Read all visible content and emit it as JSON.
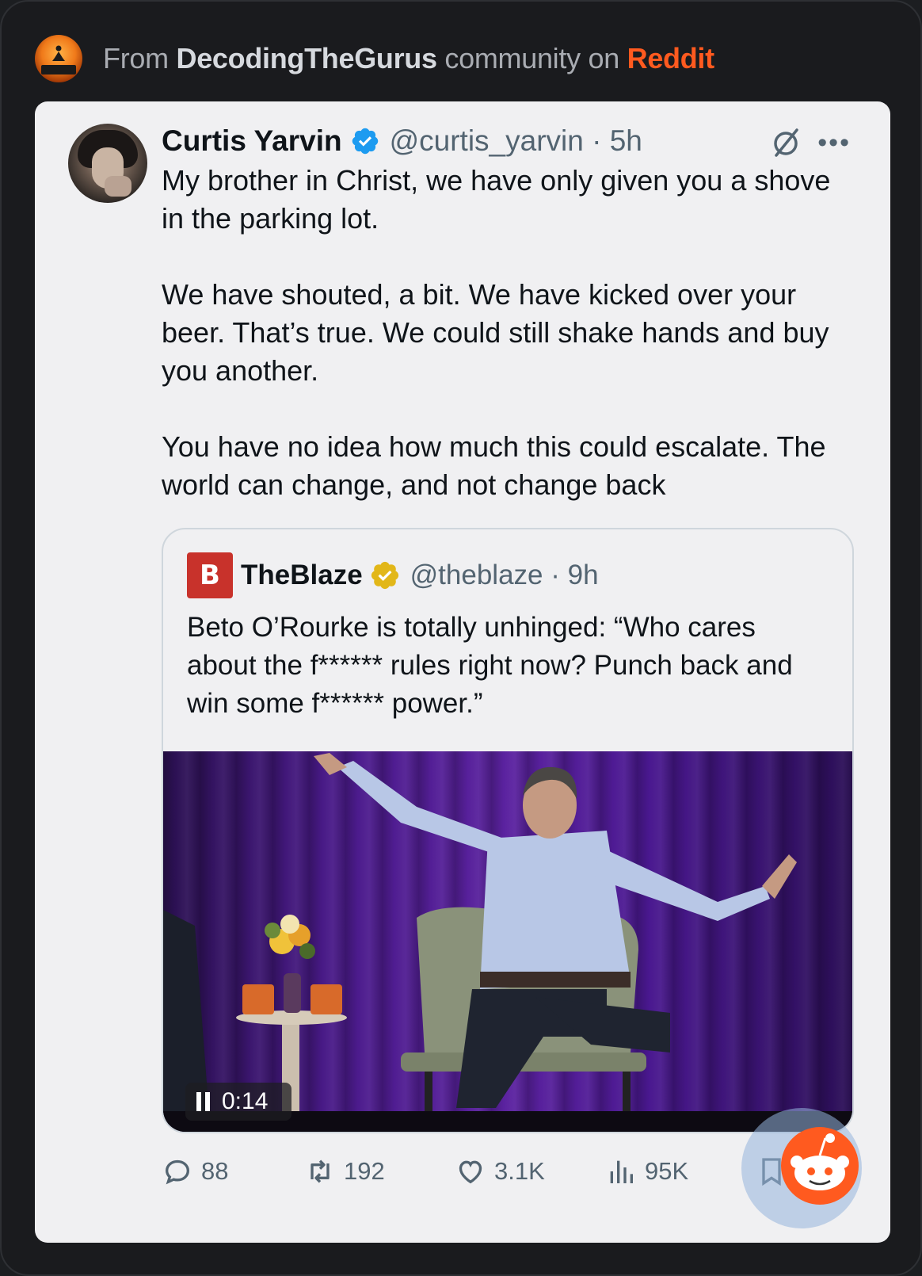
{
  "header": {
    "prefix": "From ",
    "community": "DecodingTheGurus",
    "middle": " community on ",
    "platform": "Reddit"
  },
  "tweet": {
    "display_name": "Curtis Yarvin",
    "handle_time": "@curtis_yarvin · 5h",
    "paragraphs": [
      "My brother in Christ, we have only given you a shove in the parking lot.",
      "We have shouted, a bit. We have kicked over your beer. That’s true. We could still shake hands and buy you another.",
      "You have no idea how much this could escalate. The world can change, and not change back"
    ],
    "more_label": "•••"
  },
  "quote": {
    "logo_letter": "B",
    "display_name": "TheBlaze",
    "handle_time": "@theblaze · 9h",
    "text": "Beto O’Rourke is totally unhinged: “Who cares about the f****** rules right now? Punch back and win some f****** power.”",
    "video_time": "0:14"
  },
  "actions": {
    "replies": "88",
    "reposts": "192",
    "likes": "3.1K",
    "views": "95K"
  },
  "colors": {
    "reddit_orange": "#ff5a1f",
    "verified_blue": "#1d9bf0",
    "verified_gold": "#e2b719",
    "blaze_red": "#c8322b"
  }
}
